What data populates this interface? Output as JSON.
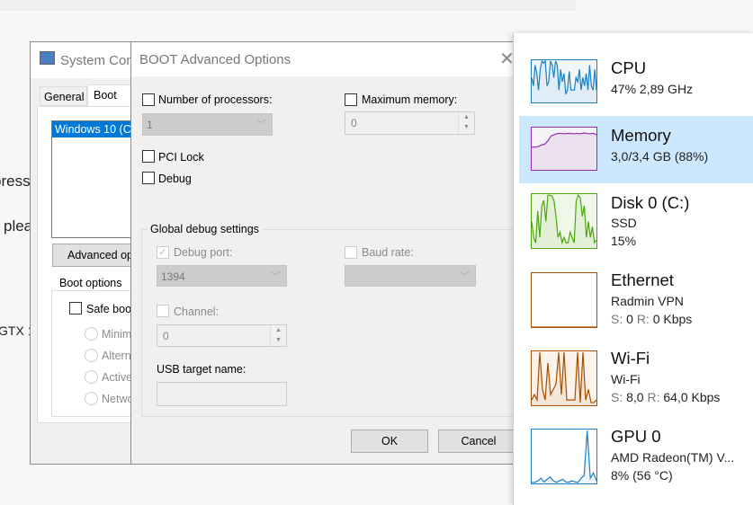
{
  "background_text": [
    "press",
    "plea",
    "GTX 1"
  ],
  "sysconfig": {
    "title": "System Con",
    "tabs": [
      "General",
      "Boot"
    ],
    "boot_entry": "Windows 10 (C",
    "advanced_button": "Advanced op",
    "boot_options_label": "Boot options",
    "safe_boot": "Safe boo",
    "radios": [
      "Minim",
      "Altern",
      "Active",
      "Netwo"
    ]
  },
  "boot_dialog": {
    "title": "BOOT Advanced Options",
    "num_processors": {
      "label": "Number of processors:",
      "value": "1",
      "checked": false
    },
    "max_memory": {
      "label": "Maximum memory:",
      "value": "0",
      "checked": false
    },
    "pci_lock": "PCI Lock",
    "debug": "Debug",
    "global_debug": {
      "legend": "Global debug settings",
      "debug_port_label": "Debug port:",
      "debug_port_value": "1394",
      "baud_rate_label": "Baud rate:",
      "channel_label": "Channel:",
      "channel_value": "0",
      "usb_label": "USB target name:",
      "usb_value": ""
    },
    "ok": "OK",
    "cancel": "Cancel"
  },
  "task_manager": {
    "items": [
      {
        "title": "CPU",
        "line1": "47%  2,89 GHz",
        "color": "#1d7fc0",
        "fill": "#f1f6fb",
        "values": [
          0.6,
          0.4,
          0.9,
          0.7,
          0.3,
          0.8,
          1,
          0.95,
          1,
          0.4,
          0.5,
          1,
          0.9,
          0.6,
          1,
          0.9,
          0.3,
          0.8,
          0.5,
          0.7,
          0.2,
          0.3,
          0.75,
          0.3,
          0.3,
          0.3,
          0.6,
          0.5,
          0.8,
          0.3,
          0.6,
          0.4,
          0.7,
          0.3,
          0.9,
          0.4,
          0.3,
          0.8,
          0.3
        ]
      },
      {
        "title": "Memory",
        "line1": "3,0/3,4 GB (88%)",
        "color": "#9528b4",
        "fill": "#f4f2f4",
        "values": [
          0.55,
          0.55,
          0.56,
          0.6,
          0.62,
          0.7,
          0.82,
          0.85,
          0.88,
          0.88,
          0.87,
          0.88,
          0.88,
          0.87,
          0.88,
          0.87,
          0.89,
          0.88,
          0.87,
          0.88,
          0.85
        ]
      },
      {
        "title": "Disk 0 (C:)",
        "line1": "SSD",
        "line2": "15%",
        "color": "#4da60c",
        "fill": "#eff7e9",
        "values": [
          0.5,
          0.2,
          0.1,
          0.7,
          0.2,
          0.8,
          0.9,
          0.5,
          1,
          1,
          0.98,
          0.9,
          0.6,
          0.2,
          0.3,
          0.1,
          0.2,
          0.1,
          0.1,
          0.3,
          0.2,
          0.1,
          0.9,
          1,
          0.95,
          0.6,
          0.8,
          0.2,
          0.5,
          0.2,
          0.4,
          0.1,
          0.15
        ]
      },
      {
        "title": "Ethernet",
        "line1": "Radmin VPN",
        "line2a": "S:",
        "line2b": " 0 ",
        "line2c": "R:",
        "line2d": " 0 Kbps",
        "color": "#a74f01",
        "fill": "#fff",
        "values": [
          0,
          0,
          0,
          0,
          0,
          0,
          0,
          0,
          0,
          0
        ]
      },
      {
        "title": "Wi-Fi",
        "line1": "Wi-Fi",
        "line2a": "S:",
        "line2b": " 8,0 ",
        "line2c": "R:",
        "line2d": " 64,0 Kbps",
        "color": "#a74f01",
        "fill": "#fdf3ea",
        "values": [
          0.1,
          0.2,
          0.1,
          1,
          0.3,
          0.1,
          0.8,
          0.2,
          0.3,
          0.4,
          1,
          0.2,
          1,
          0.1,
          0.1,
          0.1,
          0.1,
          1,
          0.05,
          1,
          0.1,
          0.3,
          0.05,
          0.05,
          0.1
        ]
      },
      {
        "title": "GPU 0",
        "line1": "AMD Radeon(TM) V...",
        "line2": "8%  (56 °C)",
        "color": "#1d7fc0",
        "fill": "#fff",
        "values": [
          0.02,
          0.02,
          0.05,
          0.1,
          0.03,
          0.08,
          0.12,
          0.05,
          0.02,
          0.05,
          0.08,
          0.03,
          0.02,
          0.05,
          0.03,
          0.02,
          0.1,
          0.15,
          1,
          0.1,
          0.2,
          0.05
        ]
      }
    ]
  }
}
